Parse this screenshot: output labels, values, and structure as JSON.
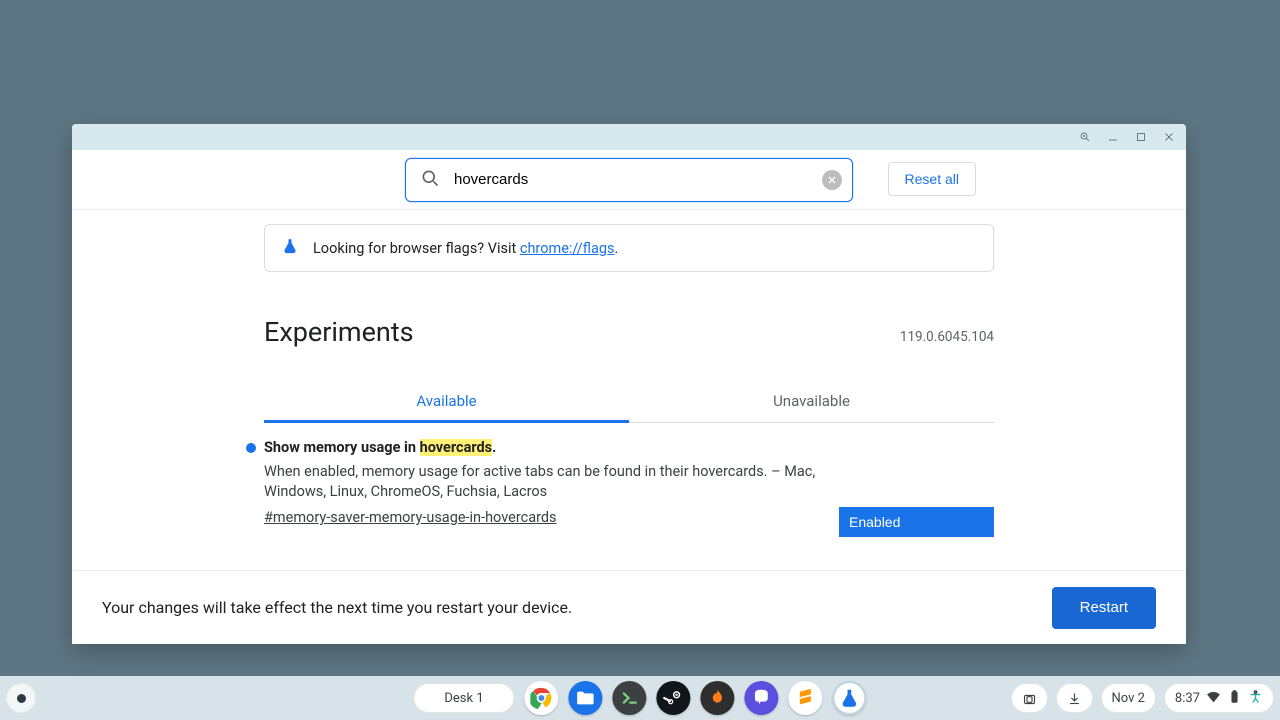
{
  "search": {
    "value": "hovercards",
    "reset_label": "Reset all"
  },
  "info": {
    "prefix": "Looking for browser flags? Visit ",
    "link_text": "chrome://flags",
    "suffix": "."
  },
  "header": {
    "title": "Experiments",
    "version": "119.0.6045.104"
  },
  "tabs": {
    "available": "Available",
    "unavailable": "Unavailable"
  },
  "flag": {
    "title_pre": "Show memory usage in ",
    "title_hl": "hovercards",
    "title_post": ".",
    "desc": "When enabled, memory usage for active tabs can be found in their hovercards. – Mac, Windows, Linux, ChromeOS, Fuchsia, Lacros",
    "anchor": "#memory-saver-memory-usage-in-hovercards",
    "select_value": "Enabled"
  },
  "footer": {
    "message": "Your changes will take effect the next time you restart your device.",
    "restart": "Restart"
  },
  "shelf": {
    "desk": "Desk 1",
    "date": "Nov 2",
    "time": "8:37"
  }
}
